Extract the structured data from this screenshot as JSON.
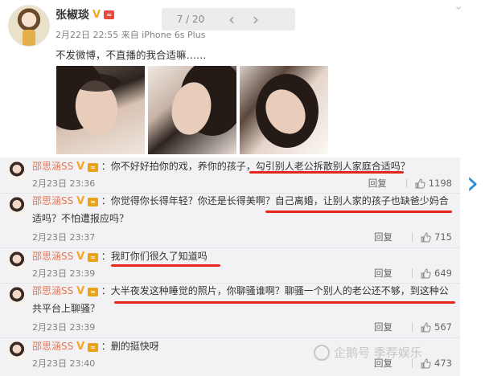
{
  "post": {
    "user_name": "张椒琰",
    "meta": "2月22日 22:55 来自 iPhone 6s Plus",
    "text": "不发微博，不直播的我合适嘛……",
    "photo_count": 3
  },
  "viewer": {
    "counter": "7 / 20",
    "prev": "‹",
    "next": "›",
    "close": "✕"
  },
  "badges": {
    "verified": "V",
    "level": "≈"
  },
  "comments": [
    {
      "user": "邵思涵SS",
      "text": "：你不好好拍你的戏，养你的孩子，勾引别人老公拆散别人家庭合适吗？",
      "time": "2月23日 23:36",
      "reply": "回复",
      "likes": "1198"
    },
    {
      "user": "邵思涵SS",
      "text": "：你觉得你长得年轻？你还是长得美啊？自己离婚，让别人家的孩子也缺爸少妈合适吗？不怕遭报应吗？",
      "time": "2月23日 23:37",
      "reply": "回复",
      "likes": "715"
    },
    {
      "user": "邵思涵SS",
      "text": "：我盯你们很久了知道吗",
      "time": "2月23日 23:39",
      "reply": "回复",
      "likes": "649"
    },
    {
      "user": "邵思涵SS",
      "text": "：大半夜发这种睡觉的照片，你聊骚谁啊？聊骚一个别人的老公还不够，到这种公共平台上聊骚？",
      "time": "2月23日 23:39",
      "reply": "回复",
      "likes": "567"
    },
    {
      "user": "邵思涵SS",
      "text": "：删的挺快呀",
      "time": "2月23日 23:40",
      "reply": "回复",
      "likes": "473"
    }
  ],
  "watermark": "企鹅号 季荐娱乐",
  "colors": {
    "username": "#eb7350",
    "underline": "#e8251d",
    "next_arrow": "#2b8fd6",
    "comment_bg": "#f2f2f5"
  }
}
